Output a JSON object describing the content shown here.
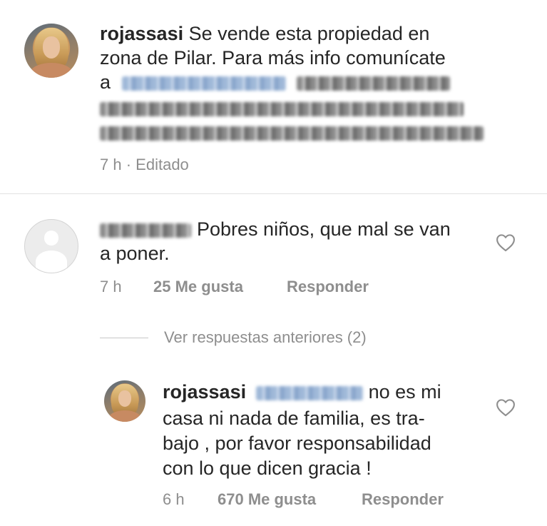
{
  "caption": {
    "username": "rojassasi",
    "text_line1": "Se vende esta propiedad en",
    "text_line2": "zona de Pilar. Para más info comunícate",
    "text_line3_prefix": "a",
    "time": "7 h",
    "separator": "·",
    "edited": "Editado"
  },
  "comment1": {
    "text_line1": "Pobres niños, que mal se van",
    "text_line2": "a poner.",
    "time": "7 h",
    "likes": "25 Me gusta",
    "reply": "Responder",
    "like_icon": "heart-outline-icon"
  },
  "view_previous": {
    "label": "Ver respuestas anteriores (2)"
  },
  "reply1": {
    "username": "rojassasi",
    "text_line1": "no es mi",
    "text_line2": "casa ni nada de familia,  es tra-",
    "text_line3": "bajo , por favor responsabilidad",
    "text_line4": "con lo que dicen gracia !",
    "time": "6 h",
    "likes": "670 Me gusta",
    "reply": "Responder",
    "like_icon": "heart-outline-icon"
  },
  "colors": {
    "text": "#262626",
    "meta": "#8e8e8e",
    "divider": "#e2e2e2"
  }
}
